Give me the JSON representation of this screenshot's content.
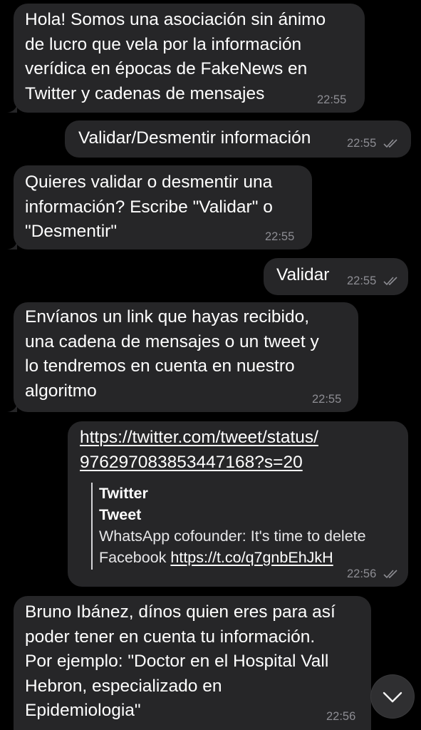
{
  "messages": [
    {
      "id": "m1",
      "direction": "incoming",
      "lines": [
        "Hola! Somos una asociación sin ánimo",
        "de lucro que vela por la información",
        "verídica en épocas de FakeNews en",
        "Twitter y cadenas de mensajes"
      ],
      "time": "22:55"
    },
    {
      "id": "m2",
      "direction": "outgoing",
      "lines": [
        "Validar/Desmentir información"
      ],
      "time": "22:55",
      "read": true
    },
    {
      "id": "m3",
      "direction": "incoming",
      "lines": [
        "Quieres validar o desmentir una",
        "información? Escribe \"Validar\" o",
        "\"Desmentir\""
      ],
      "time": "22:55"
    },
    {
      "id": "m4",
      "direction": "outgoing",
      "lines": [
        "Validar"
      ],
      "time": "22:55",
      "read": true
    },
    {
      "id": "m5",
      "direction": "incoming",
      "lines": [
        "Envíanos un link que hayas recibido,",
        "una cadena de mensajes o un tweet y",
        "lo tendremos en cuenta en nuestro",
        "algoritmo"
      ],
      "time": "22:55"
    },
    {
      "id": "m6",
      "direction": "outgoing",
      "link_lines": [
        "https://twitter.com/tweet/status/",
        "976297083853447168?s=20"
      ],
      "preview": {
        "title_line1": "Twitter",
        "title_line2": "Tweet",
        "desc_line1": "WhatsApp cofounder: It's time to delete",
        "desc_prefix": "Facebook ",
        "desc_link": "https://t.co/q7gnbEhJkH"
      },
      "time": "22:56",
      "read": true
    },
    {
      "id": "m7",
      "direction": "incoming",
      "lines": [
        "Bruno Ibánez, dínos quien eres para así",
        "poder tener en cuenta tu información.",
        "Por ejemplo: \"Doctor en el Hospital Vall",
        "Hebron, especializado en",
        "Epidemiologia\""
      ],
      "time": "22:56"
    }
  ],
  "icons": {
    "read_receipt": "double-check-icon",
    "scroll_down": "chevron-down-icon"
  },
  "colors": {
    "background": "#000000",
    "bubble": "#262628",
    "text": "#ffffff",
    "timestamp": "#8d8d93"
  }
}
